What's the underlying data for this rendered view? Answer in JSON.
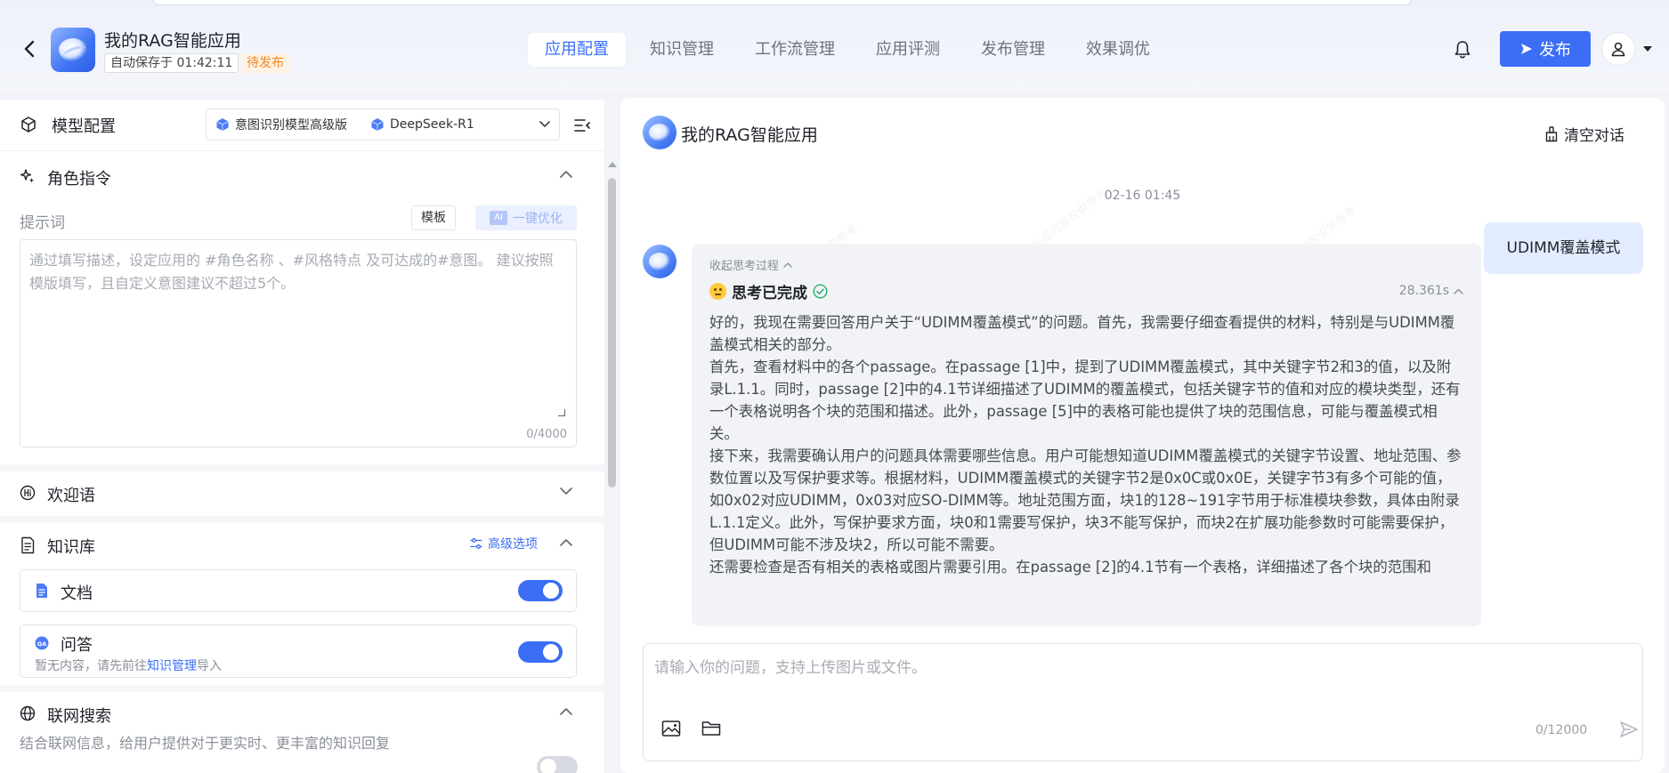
{
  "header": {
    "app_title": "我的RAG智能应用",
    "autosave": "自动保存于 01:42:11",
    "status_badge": "待发布",
    "tabs": [
      {
        "label": "应用配置",
        "active": true
      },
      {
        "label": "知识管理",
        "active": false
      },
      {
        "label": "工作流管理",
        "active": false
      },
      {
        "label": "应用评测",
        "active": false
      },
      {
        "label": "发布管理",
        "active": false
      },
      {
        "label": "效果调优",
        "active": false
      }
    ],
    "publish_label": "发布"
  },
  "left": {
    "model_config_title": "模型配置",
    "model_select": {
      "intent_model": "意图识别模型高级版",
      "main_model": "DeepSeek-R1"
    },
    "role_section_title": "角色指令",
    "prompt_label": "提示词",
    "template_label": "模板",
    "ai_chip": "AI",
    "optimize_label": "一键优化",
    "prompt_placeholder": "通过填写描述，设定应用的 #角色名称 、#风格特点 及可达成的#意图。 建议按照模版填写，且自定义意图建议不超过5个。",
    "prompt_value": "",
    "prompt_count": "0/4000",
    "welcome_title": "欢迎语",
    "kb_title": "知识库",
    "advanced_options": "高级选项",
    "kb_items": [
      {
        "title": "文档",
        "sub_prefix": "",
        "sub_link": "",
        "sub_suffix": "",
        "enabled": true
      },
      {
        "title": "问答",
        "sub_prefix": "暂无内容，请先前往",
        "sub_link": "知识管理",
        "sub_suffix": "导入",
        "enabled": true
      }
    ],
    "web_search_title": "联网搜索",
    "web_search_desc": "结合联网信息，给用户提供对于更实时、更丰富的知识回复",
    "web_search_enabled": false
  },
  "chat": {
    "title": "我的RAG智能应用",
    "clear_label": "清空对话",
    "timestamp": "02-16 01:45",
    "user_message": "UDIMM覆盖模式",
    "collapse_label": "收起思考过程",
    "thinking_done": "思考已完成",
    "thinking_time": "28.361s",
    "thinking_paragraphs": [
      "好的，我现在需要回答用户关于“UDIMM覆盖模式”的问题。首先，我需要仔细查看提供的材料，特别是与UDIMM覆盖模式相关的部分。",
      "首先，查看材料中的各个passage。在passage [1]中，提到了UDIMM覆盖模式，其中关键字节2和3的值，以及附录L.1.1。同时，passage [2]中的4.1节详细描述了UDIMM的覆盖模式，包括关键字节的值和对应的模块类型，还有一个表格说明各个块的范围和描述。此外，passage [5]中的表格可能也提供了块的范围信息，可能与覆盖模式相关。",
      "接下来，我需要确认用户的问题具体需要哪些信息。用户可能想知道UDIMM覆盖模式的关键字节设置、地址范围、参数位置以及写保护要求等。根据材料，UDIMM覆盖模式的关键字节2是0x0C或0x0E，关键字节3有多个可能的值，如0x02对应UDIMM，0x03对应SO-DIMM等。地址范围方面，块1的128~191字节用于标准模块参数，具体由附录L.1.1定义。此外，写保护要求方面，块0和1需要写保护，块3不能写保护，而块2在扩展功能参数时可能需要保护，但UDIMM可能不涉及块2，所以可能不需要。",
      "还需要检查是否有相关的表格或图片需要引用。在passage [2]的4.1节有一个表格，详细描述了各个块的范围和"
    ],
    "input_placeholder": "请输入你的问题，支持上传图片或文件。",
    "input_value": "",
    "input_count": "0/12000"
  },
  "colors": {
    "accent": "#3b6ef5",
    "badge_text": "#f08a24",
    "badge_bg": "#fff1e3",
    "user_bubble": "#e3ebff",
    "bot_bubble": "#f2f3f6"
  },
  "icons": {
    "back": "chevron-left-icon",
    "bell": "bell-icon",
    "publish": "send-icon",
    "user": "user-icon",
    "model": "cube-icon",
    "role": "sparkle-icon",
    "welcome": "hi-icon",
    "kb": "document-icon",
    "web": "globe-icon",
    "clear": "broom-icon",
    "image": "image-icon",
    "folder": "folder-icon",
    "send": "send-icon"
  }
}
